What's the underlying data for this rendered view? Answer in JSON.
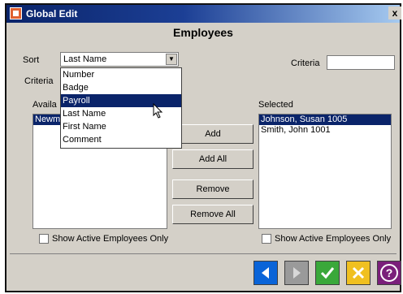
{
  "window": {
    "title": "Global Edit",
    "close_label": "x"
  },
  "heading": "Employees",
  "sort": {
    "label": "Sort",
    "value": "Last Name",
    "options": [
      "Number",
      "Badge",
      "Payroll",
      "Last Name",
      "First Name",
      "Comment"
    ],
    "highlighted": "Payroll"
  },
  "criteria": {
    "label_left": "Criteria",
    "label_right": "Criteria",
    "value": ""
  },
  "available": {
    "label": "Available",
    "label_visible": "Availa",
    "items": [
      "Newm"
    ],
    "selected_item": "Newm"
  },
  "selected": {
    "label": "Selected",
    "items": [
      "Johnson, Susan 1005",
      "Smith, John 1001"
    ],
    "selected_item": "Johnson, Susan 1005"
  },
  "buttons": {
    "add": "Add",
    "add_all": "Add All",
    "remove": "Remove",
    "remove_all": "Remove All"
  },
  "checkboxes": {
    "left": "Show Active Employees Only",
    "right": "Show Active Employees Only"
  },
  "footer": {
    "icons": [
      "back-icon",
      "forward-icon",
      "ok-icon",
      "cancel-icon",
      "help-icon"
    ]
  },
  "colors": {
    "title_bar": "#0a246a",
    "selection": "#0a246a",
    "back_button": "#0a64d8",
    "ok_button": "#3aa83a",
    "cancel_button": "#f0c020",
    "help_button": "#7a1f7a"
  }
}
